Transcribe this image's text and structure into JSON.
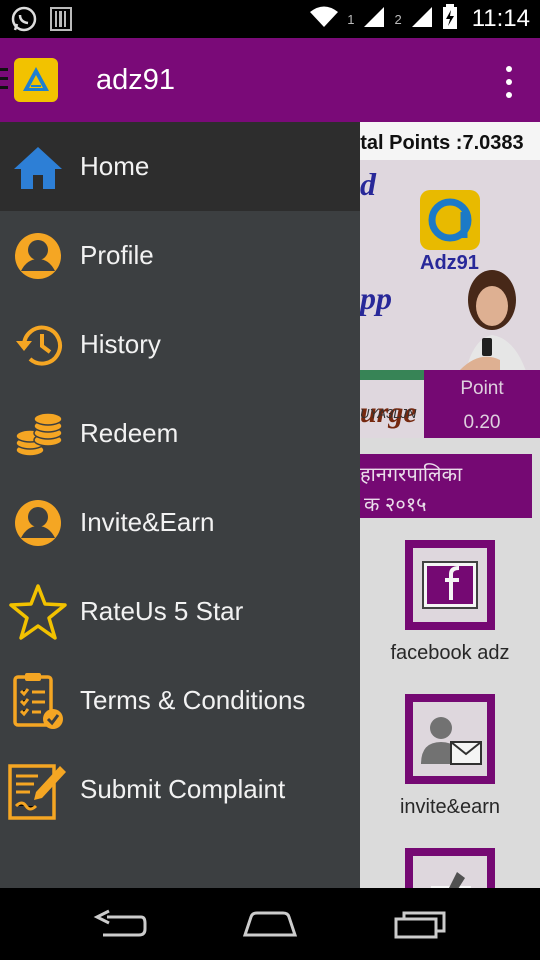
{
  "status_bar": {
    "sim1": "1",
    "sim2": "2",
    "time": "11:14",
    "icons": [
      "whatsapp-icon",
      "barcode-icon",
      "wifi-icon",
      "signal-icon",
      "signal-icon",
      "battery-charging-icon"
    ]
  },
  "app_bar": {
    "title": "adz91",
    "logo_icon": "app-logo-icon",
    "menu_icon": "overflow-menu-icon"
  },
  "main": {
    "total_points": "otal Points :7.0383",
    "banner": {
      "text_d": "d",
      "logo_text": "Adz91",
      "text_pp": "pp",
      "text_urge": "urge",
      "code": "UYA3LJN"
    },
    "point_box": {
      "label": "Point",
      "value": "0.20"
    },
    "notice": {
      "line1": "हानगरपालिका",
      "line2": "क  २०१५"
    },
    "tiles": [
      {
        "label": "facebook adz",
        "icon": "facebook-icon"
      },
      {
        "label": "invite&earn",
        "icon": "contact-mail-icon"
      },
      {
        "label": "",
        "icon": "pen-icon"
      }
    ]
  },
  "drawer": {
    "items": [
      {
        "label": "Home",
        "icon": "home-icon",
        "active": true
      },
      {
        "label": "Profile",
        "icon": "profile-icon"
      },
      {
        "label": "History",
        "icon": "history-icon"
      },
      {
        "label": "Redeem",
        "icon": "coins-icon"
      },
      {
        "label": "Invite&Earn",
        "icon": "invite-icon"
      },
      {
        "label": "RateUs 5 Star",
        "icon": "star-icon"
      },
      {
        "label": "Terms & Conditions",
        "icon": "clipboard-check-icon"
      },
      {
        "label": "Submit Complaint",
        "icon": "complaint-form-icon"
      }
    ]
  },
  "nav_bar": {
    "icons": [
      "back-icon",
      "home-button-icon",
      "recents-icon"
    ]
  },
  "colors": {
    "primary": "#7a0a78",
    "drawer_bg": "#3c3f41",
    "drawer_active": "#2d2d2d",
    "icon_orange": "#f5a623",
    "icon_blue": "#2d7fd6",
    "icon_yellow": "#f2c200"
  }
}
